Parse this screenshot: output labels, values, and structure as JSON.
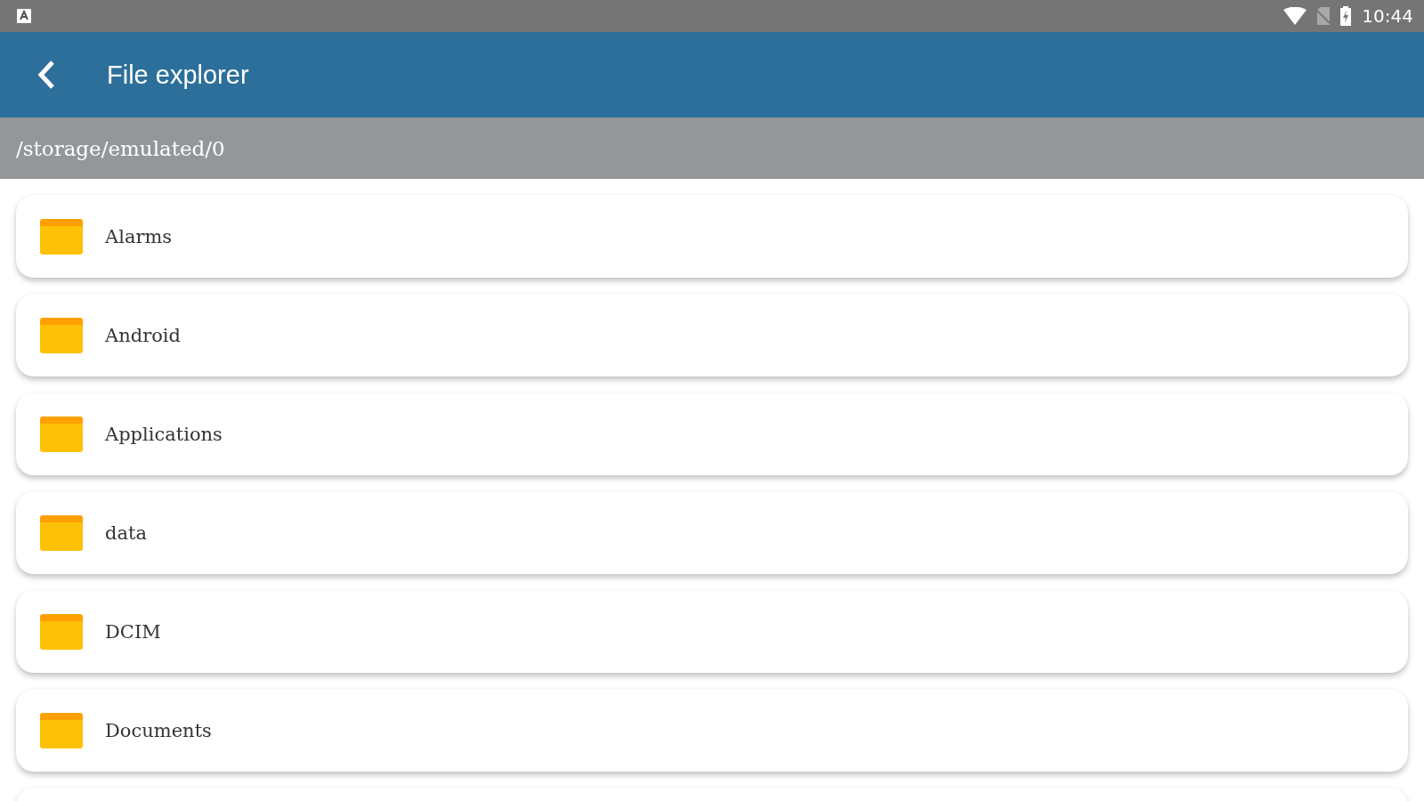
{
  "status_bar": {
    "time": "10:44"
  },
  "app_bar": {
    "title": "File explorer"
  },
  "path": "/storage/emulated/0",
  "folders": [
    {
      "name": "Alarms"
    },
    {
      "name": "Android"
    },
    {
      "name": "Applications"
    },
    {
      "name": "data"
    },
    {
      "name": "DCIM"
    },
    {
      "name": "Documents"
    }
  ]
}
